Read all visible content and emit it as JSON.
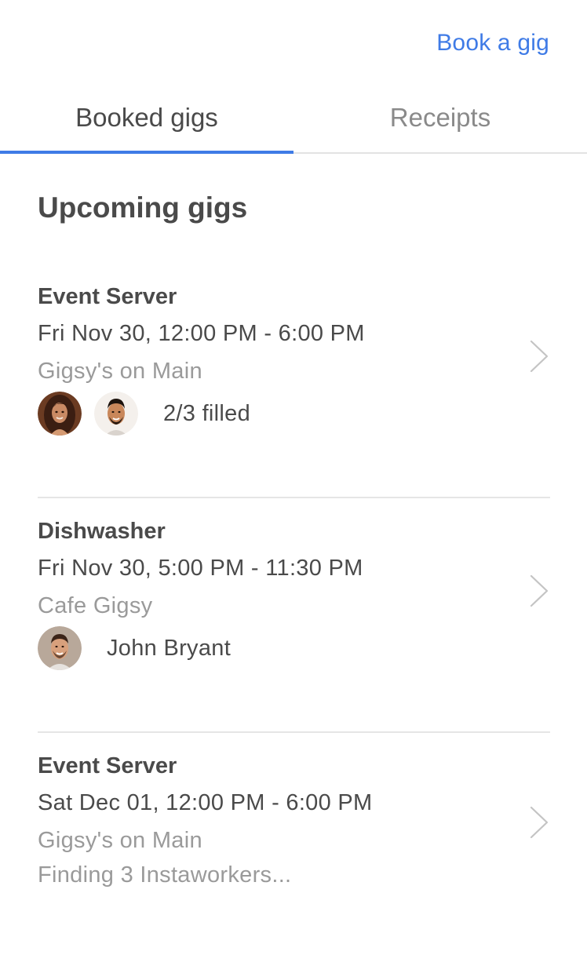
{
  "header": {
    "book_link": "Book a gig"
  },
  "tabs": [
    {
      "label": "Booked gigs",
      "active": true
    },
    {
      "label": "Receipts",
      "active": false
    }
  ],
  "section_title": "Upcoming gigs",
  "gigs": [
    {
      "role": "Event Server",
      "time": "Fri Nov 30, 12:00 PM - 6:00 PM",
      "venue": "Gigsy's on Main",
      "status": "2/3 filled",
      "avatars": [
        "woman-avatar",
        "man-avatar"
      ]
    },
    {
      "role": "Dishwasher",
      "time": "Fri Nov 30, 5:00 PM - 11:30 PM",
      "venue": "Cafe Gigsy",
      "status": "John Bryant",
      "avatars": [
        "man-avatar"
      ]
    },
    {
      "role": "Event Server",
      "time": "Sat Dec 01, 12:00 PM - 6:00 PM",
      "venue": "Gigsy's on Main",
      "status": "Finding 3 Instaworkers..."
    }
  ],
  "colors": {
    "accent": "#3f7be6",
    "text": "#4a4a4a",
    "muted": "#9a9a9a",
    "divider": "#e5e5e5"
  },
  "icons": {
    "chevron": "chevron-right-icon"
  }
}
